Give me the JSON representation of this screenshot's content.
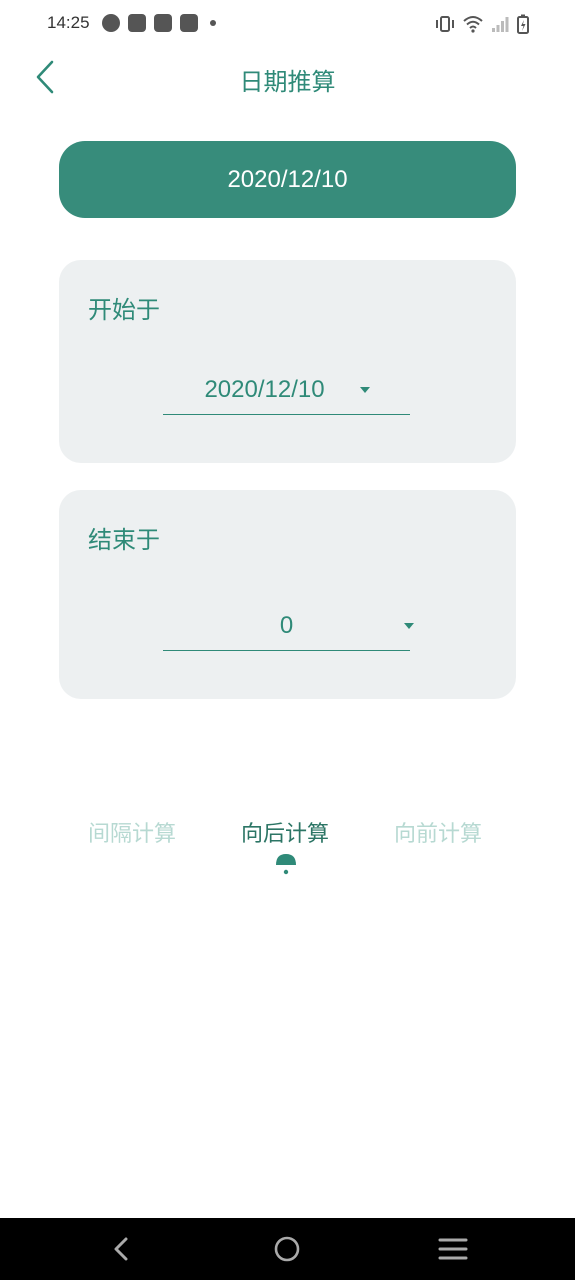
{
  "status_bar": {
    "time": "14:25"
  },
  "header": {
    "title": "日期推算"
  },
  "result": {
    "value": "2020/12/10"
  },
  "start_card": {
    "label": "开始于",
    "value": "2020/12/10"
  },
  "end_card": {
    "label": "结束于",
    "value": "0"
  },
  "tabs": [
    {
      "label": "间隔计算",
      "active": false
    },
    {
      "label": "向后计算",
      "active": true
    },
    {
      "label": "向前计算",
      "active": false
    }
  ],
  "colors": {
    "accent": "#378c7b",
    "text_accent": "#2f8a78",
    "card_bg": "#edf0f1",
    "tab_inactive": "#b7d9d2"
  }
}
